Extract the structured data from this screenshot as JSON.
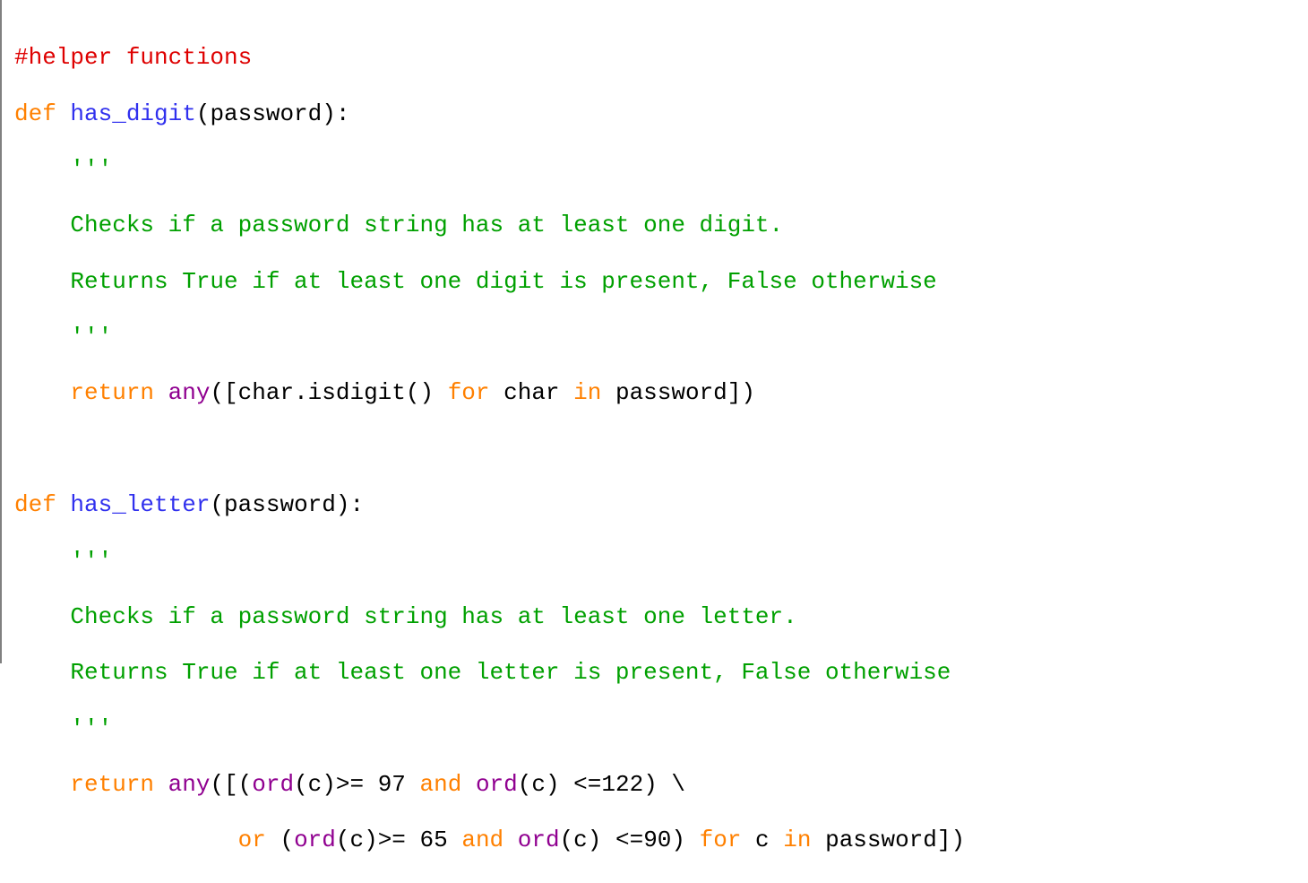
{
  "code": {
    "l1_comment": "#helper functions",
    "l2_def": "def",
    "l2_fname": " has_digit",
    "l2_params": "(password):",
    "l3_docstart": "    '''",
    "l4_doc": "    Checks if a password string has at least one digit.",
    "l5_doc": "    Returns True if at least one digit is present, False otherwise",
    "l6_docend": "    '''",
    "l7_ret": "    return",
    "l7_sp": " ",
    "l7_any": "any",
    "l7_p1": "([char.isdigit() ",
    "l7_for": "for",
    "l7_p2": " char ",
    "l7_in": "in",
    "l7_p3": " password])",
    "l9_def": "def",
    "l9_fname": " has_letter",
    "l9_params": "(password):",
    "l10_docstart": "    '''",
    "l11_doc": "    Checks if a password string has at least one letter.",
    "l12_doc": "    Returns True if at least one letter is present, False otherwise",
    "l13_docend": "    '''",
    "l14_ret": "    return",
    "l14_sp": " ",
    "l14_any": "any",
    "l14_p1": "([(",
    "l14_ord1": "ord",
    "l14_p2": "(c)>= ",
    "l14_n97": "97",
    "l14_sp2": " ",
    "l14_and1": "and",
    "l14_sp3": " ",
    "l14_ord2": "ord",
    "l14_p3": "(c) <=",
    "l14_n122": "122",
    "l14_p4": ") \\",
    "l15_indent": "                ",
    "l15_or": "or",
    "l15_p1": " (",
    "l15_ord1": "ord",
    "l15_p2": "(c)>= ",
    "l15_n65": "65",
    "l15_sp2": " ",
    "l15_and1": "and",
    "l15_sp3": " ",
    "l15_ord2": "ord",
    "l15_p3": "(c) <=",
    "l15_n90": "90",
    "l15_p4": ") ",
    "l15_for": "for",
    "l15_p5": " c ",
    "l15_in": "in",
    "l15_p6": " password])"
  }
}
